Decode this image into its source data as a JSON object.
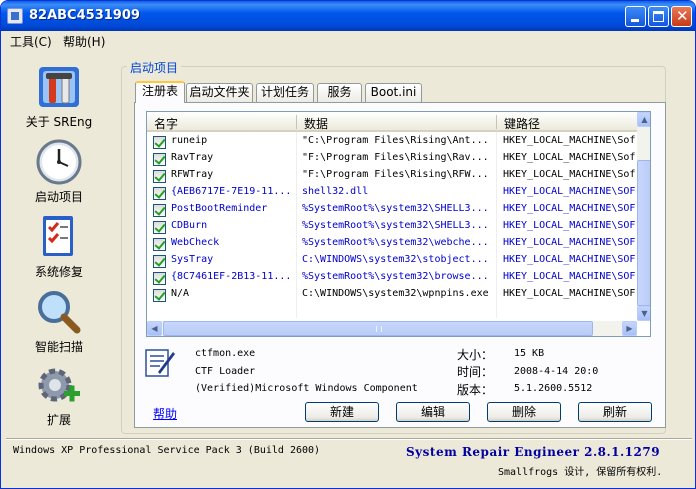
{
  "window": {
    "title": "82ABC4531909"
  },
  "menu": [
    {
      "label": "工具(C)"
    },
    {
      "label": "帮助(H)"
    }
  ],
  "nav": [
    {
      "label": "关于 SREng",
      "icon": "tools-icon"
    },
    {
      "label": "启动项目",
      "icon": "clock-icon"
    },
    {
      "label": "系统修复",
      "icon": "checklist-icon"
    },
    {
      "label": "智能扫描",
      "icon": "magnifier-icon"
    },
    {
      "label": "扩展",
      "icon": "gear-plus-icon"
    }
  ],
  "group_title": "启动项目",
  "tabs": [
    {
      "label": "注册表",
      "active": true
    },
    {
      "label": "启动文件夹"
    },
    {
      "label": "计划任务"
    },
    {
      "label": "服务"
    },
    {
      "label": "Boot.ini"
    }
  ],
  "list": {
    "columns": [
      "名字",
      "数据",
      "键路径"
    ],
    "rows": [
      {
        "name": "runeip",
        "data": "\"C:\\Program Files\\Rising\\Ant...",
        "key": "HKEY_LOCAL_MACHINE\\Sof",
        "checked": true,
        "blue": false
      },
      {
        "name": "RavTray",
        "data": "\"F:\\Program Files\\Rising\\Rav...",
        "key": "HKEY_LOCAL_MACHINE\\Sof",
        "checked": true,
        "blue": false
      },
      {
        "name": "RFWTray",
        "data": "\"F:\\Program Files\\Rising\\RFW...",
        "key": "HKEY_LOCAL_MACHINE\\Sof",
        "checked": true,
        "blue": false
      },
      {
        "name": "{AEB6717E-7E19-11...",
        "data": "shell32.dll",
        "key": "HKEY_LOCAL_MACHINE\\SOF",
        "checked": true,
        "blue": true
      },
      {
        "name": "PostBootReminder",
        "data": "%SystemRoot%\\system32\\SHELL3...",
        "key": "HKEY_LOCAL_MACHINE\\SOF",
        "checked": true,
        "blue": true
      },
      {
        "name": "CDBurn",
        "data": "%SystemRoot%\\system32\\SHELL3...",
        "key": "HKEY_LOCAL_MACHINE\\SOF",
        "checked": true,
        "blue": true
      },
      {
        "name": "WebCheck",
        "data": "%SystemRoot%\\system32\\webche...",
        "key": "HKEY_LOCAL_MACHINE\\SOF",
        "checked": true,
        "blue": true
      },
      {
        "name": "SysTray",
        "data": "C:\\WINDOWS\\system32\\stobject...",
        "key": "HKEY_LOCAL_MACHINE\\SOF",
        "checked": true,
        "blue": true
      },
      {
        "name": "{8C7461EF-2B13-11...",
        "data": "%SystemRoot%\\system32\\browse...",
        "key": "HKEY_LOCAL_MACHINE\\SOF",
        "checked": true,
        "blue": true
      },
      {
        "name": "N/A",
        "data": "C:\\WINDOWS\\system32\\wpnpins.exe",
        "key": "HKEY_LOCAL_MACHINE\\SOF",
        "checked": true,
        "blue": false
      }
    ]
  },
  "details": {
    "file": "ctfmon.exe",
    "description": "CTF Loader",
    "company": "(Verified)Microsoft Windows Component",
    "size_label": "大小：",
    "size": "15 KB",
    "time_label": "时间：",
    "time": "2008-4-14 20:0",
    "version_label": "版本：",
    "version": "5.1.2600.5512"
  },
  "help_link": "帮助",
  "buttons": {
    "new": "新建",
    "edit": "编辑",
    "delete": "删除",
    "refresh": "刷新"
  },
  "status": {
    "os": "Windows XP Professional Service Pack 3 (Build 2600)",
    "app": "System Repair Engineer 2.8.1.1279",
    "copyright": "Smallfrogs 设计, 保留所有权利."
  },
  "colors": {
    "title_bar": "#0054e3",
    "link": "#0000ff",
    "blue_entry": "#0000cc",
    "app_name": "#0000a0"
  }
}
